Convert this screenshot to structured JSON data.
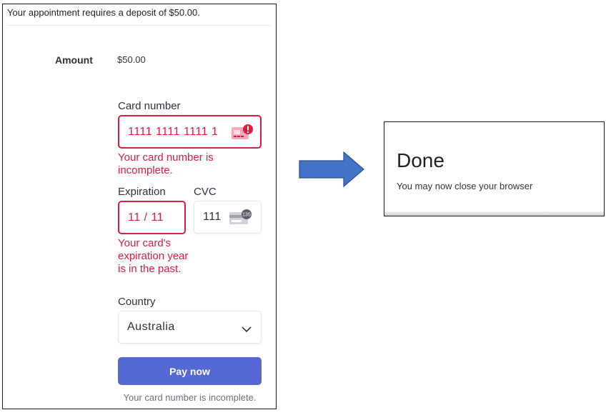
{
  "payment": {
    "notice": "Your appointment requires a deposit of $50.00.",
    "amount_label": "Amount",
    "amount_value": "$50.00",
    "card_number_label": "Card number",
    "card_number_value": "1111 1111 1111 1",
    "card_number_error": "Your card number is incomplete.",
    "expiration_label": "Expiration",
    "expiration_value": "11 / 11",
    "expiration_error": "Your card's expiration year is in the past.",
    "cvc_label": "CVC",
    "cvc_value": "111",
    "cvc_icon_number": "135",
    "country_label": "Country",
    "country_value": "Australia",
    "pay_button": "Pay now",
    "footer_error": "Your card number is incomplete."
  },
  "result": {
    "title": "Done",
    "message": "You may now close your browser"
  },
  "colors": {
    "error": "#df1b41",
    "button": "#5469d4",
    "arrow": "#4472c4"
  }
}
